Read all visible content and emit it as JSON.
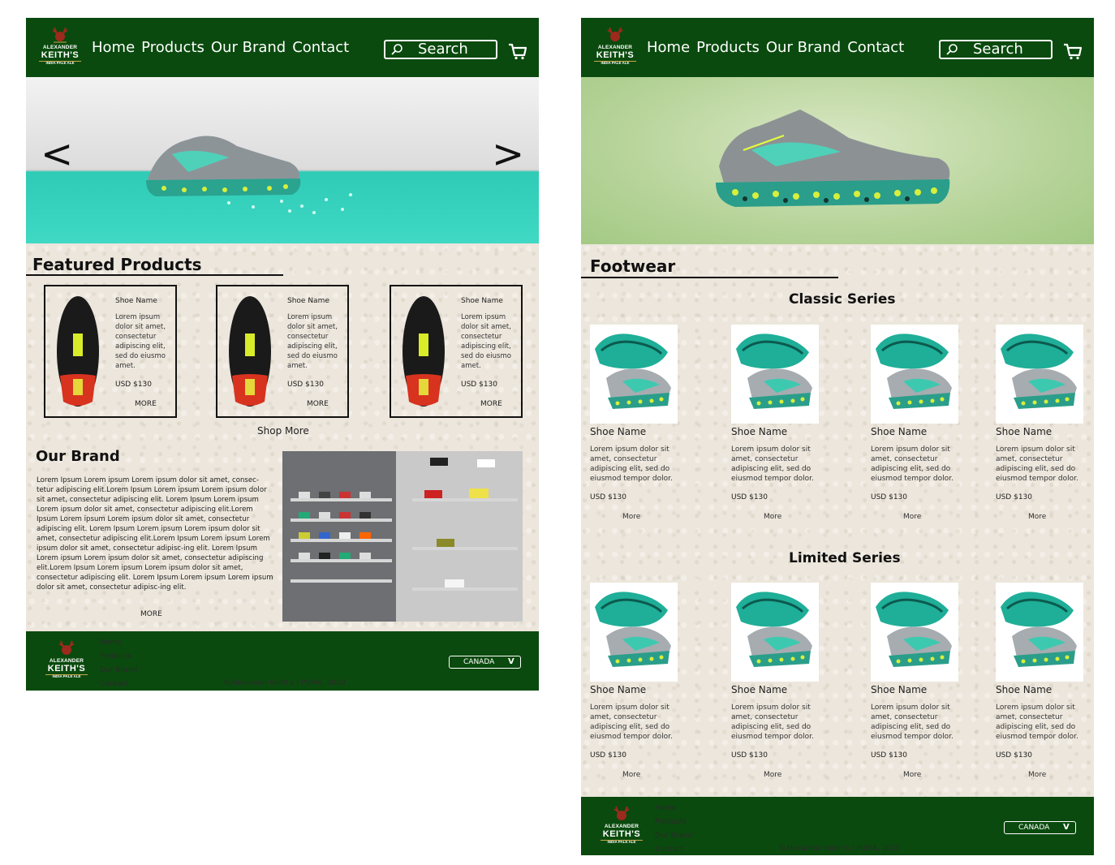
{
  "logo": {
    "line1": "ALEXANDER",
    "line2": "KEITH'S",
    "line3": "INDIA PALE ALE"
  },
  "header": {
    "nav": [
      "Home",
      "Products",
      "Our Brand",
      "Contact"
    ],
    "search_label": "Search"
  },
  "home": {
    "hero": {
      "prev": "<",
      "next": ">"
    },
    "featured_title": "Featured Products",
    "featured": [
      {
        "name": "Shoe Name",
        "desc": "Lorem ipsum dolor sit amet, consectetur adipiscing elit, sed do eiusmo amet.",
        "price": "USD $130",
        "more": "MORE"
      },
      {
        "name": "Shoe Name",
        "desc": "Lorem ipsum dolor sit amet, consectetur adipiscing elit, sed do eiusmo amet.",
        "price": "USD $130",
        "more": "MORE"
      },
      {
        "name": "Shoe Name",
        "desc": "Lorem ipsum dolor sit amet, consectetur adipiscing elit, sed do eiusmo amet.",
        "price": "USD $130",
        "more": "MORE"
      }
    ],
    "shop_more": "Shop More",
    "brand_title": "Our Brand",
    "brand_text": "Lorem Ipsum Lorem ipsum Lorem ipsum dolor sit amet, consec-tetur adipiscing elit.Lorem Ipsum Lorem ipsum Lorem ipsum dolor sit amet, consectetur adipiscing elit. Lorem Ipsum Lorem ipsum Lorem ipsum dolor sit amet, consectetur adipiscing elit.Lorem Ipsum Lorem ipsum Lorem ipsum dolor sit amet, consectetur adipiscing elit. Lorem Ipsum Lorem ipsum Lorem ipsum dolor sit amet, consectetur adipiscing elit.Lorem Ipsum Lorem ipsum Lorem ipsum dolor sit amet, consectetur adipisc-ing elit. Lorem Ipsum Lorem ipsum Lorem ipsum dolor sit amet, consectetur adipiscing elit.Lorem Ipsum Lorem ipsum Lorem ipsum dolor sit amet, consectetur adipiscing elit. Lorem Ipsum Lorem ipsum Lorem ipsum dolor sit amet, consectetur adipisc-ing elit.",
    "brand_more": "MORE"
  },
  "footwear": {
    "title": "Footwear",
    "classic_title": "Classic Series",
    "limited_title": "Limited Series",
    "product": {
      "name": "Shoe Name",
      "desc": "Lorem ipsum dolor sit amet, consectetur adipiscing elit, sed do eiusmod tempor dolor.",
      "price": "USD $130",
      "more": "More"
    }
  },
  "footer": {
    "links": [
      "Home",
      "Products",
      "Our Brand",
      "Contact"
    ],
    "copyright": "©Alexander Keith's / PUMA, 2020",
    "country": "CANADA",
    "country_chevron": "V"
  },
  "colors": {
    "header_green": "#0a4a0e",
    "paper": "#ece6dc",
    "accent_teal": "#22b4a0"
  }
}
